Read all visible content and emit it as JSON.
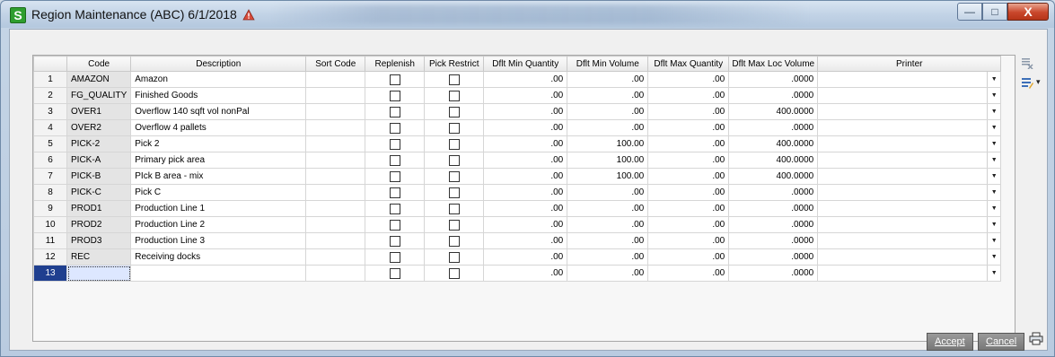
{
  "window": {
    "title": "Region Maintenance (ABC) 6/1/2018",
    "app_icon_letter": "S",
    "minimize_symbol": "—",
    "maximize_symbol": "□",
    "close_symbol": "X"
  },
  "grid": {
    "columns": [
      "",
      "Code",
      "Description",
      "Sort Code",
      "Replenish",
      "Pick Restrict",
      "Dflt Min Quantity",
      "Dflt Min Volume",
      "Dflt Max Quantity",
      "Dflt Max Loc Volume",
      "Printer"
    ],
    "rows": [
      {
        "n": "1",
        "code": "AMAZON",
        "desc": "Amazon",
        "sort": "",
        "min_qty": ".00",
        "min_vol": ".00",
        "max_qty": ".00",
        "max_loc_vol": ".0000"
      },
      {
        "n": "2",
        "code": "FG_QUALITY",
        "desc": "Finished Goods",
        "sort": "",
        "min_qty": ".00",
        "min_vol": ".00",
        "max_qty": ".00",
        "max_loc_vol": ".0000"
      },
      {
        "n": "3",
        "code": "OVER1",
        "desc": "Overflow 140 sqft vol nonPal",
        "sort": "",
        "min_qty": ".00",
        "min_vol": ".00",
        "max_qty": ".00",
        "max_loc_vol": "400.0000"
      },
      {
        "n": "4",
        "code": "OVER2",
        "desc": "Overflow 4 pallets",
        "sort": "",
        "min_qty": ".00",
        "min_vol": ".00",
        "max_qty": ".00",
        "max_loc_vol": ".0000"
      },
      {
        "n": "5",
        "code": "PICK-2",
        "desc": "Pick 2",
        "sort": "",
        "min_qty": ".00",
        "min_vol": "100.00",
        "max_qty": ".00",
        "max_loc_vol": "400.0000"
      },
      {
        "n": "6",
        "code": "PICK-A",
        "desc": "Primary pick area",
        "sort": "",
        "min_qty": ".00",
        "min_vol": "100.00",
        "max_qty": ".00",
        "max_loc_vol": "400.0000"
      },
      {
        "n": "7",
        "code": "PICK-B",
        "desc": "PIck B area - mix",
        "sort": "",
        "min_qty": ".00",
        "min_vol": "100.00",
        "max_qty": ".00",
        "max_loc_vol": "400.0000"
      },
      {
        "n": "8",
        "code": "PICK-C",
        "desc": "Pick C",
        "sort": "",
        "min_qty": ".00",
        "min_vol": ".00",
        "max_qty": ".00",
        "max_loc_vol": ".0000"
      },
      {
        "n": "9",
        "code": "PROD1",
        "desc": "Production Line 1",
        "sort": "",
        "min_qty": ".00",
        "min_vol": ".00",
        "max_qty": ".00",
        "max_loc_vol": ".0000"
      },
      {
        "n": "10",
        "code": "PROD2",
        "desc": "Production Line 2",
        "sort": "",
        "min_qty": ".00",
        "min_vol": ".00",
        "max_qty": ".00",
        "max_loc_vol": ".0000"
      },
      {
        "n": "11",
        "code": "PROD3",
        "desc": "Production Line 3",
        "sort": "",
        "min_qty": ".00",
        "min_vol": ".00",
        "max_qty": ".00",
        "max_loc_vol": ".0000"
      },
      {
        "n": "12",
        "code": "REC",
        "desc": "Receiving docks",
        "sort": "",
        "min_qty": ".00",
        "min_vol": ".00",
        "max_qty": ".00",
        "max_loc_vol": ".0000"
      },
      {
        "n": "13",
        "code": "",
        "desc": "",
        "sort": "",
        "min_qty": ".00",
        "min_vol": ".00",
        "max_qty": ".00",
        "max_loc_vol": ".0000"
      }
    ],
    "selected_row": "13",
    "dropdown_arrow": "▼"
  },
  "side_tools": {
    "delete_row_glyph": "≣",
    "customize_glyph": "≣",
    "customize_arrow": "▾"
  },
  "buttons": {
    "accept": "Accept",
    "cancel": "Cancel"
  },
  "colors": {
    "selected_row_number": "#1f3f8f",
    "app_icon": "#2f9e2f",
    "close_button": "#c9462b"
  }
}
